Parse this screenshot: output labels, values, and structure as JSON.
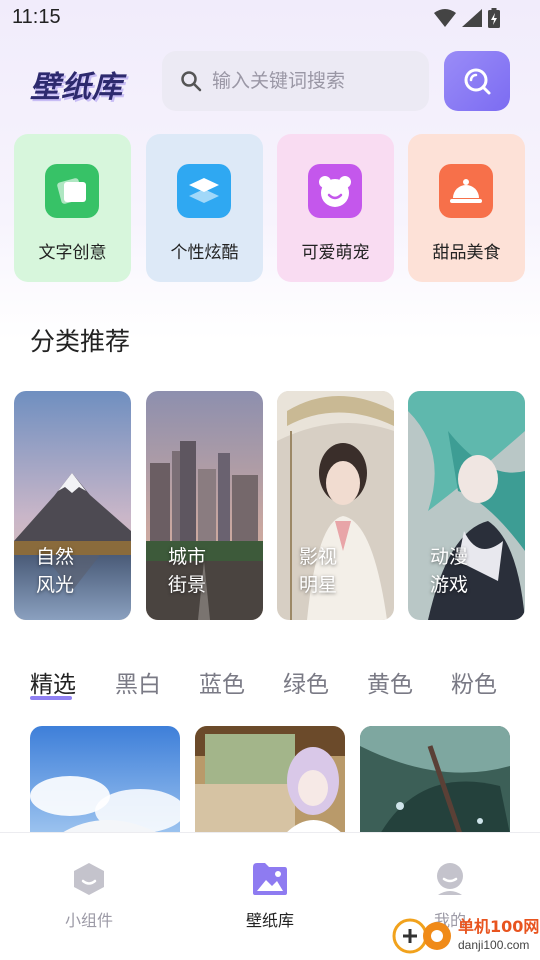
{
  "status_bar": {
    "time": "11:15"
  },
  "header": {
    "logo": "壁纸库",
    "search": {
      "placeholder": "输入关键词搜索",
      "value": ""
    }
  },
  "quick_categories": [
    {
      "label": "文字创意",
      "bg": "#d7f6dc",
      "icon_bg": "#37c267",
      "icon": "cards-icon"
    },
    {
      "label": "个性炫酷",
      "bg": "#dde9f7",
      "icon_bg": "#2fa8f2",
      "icon": "layers-icon"
    },
    {
      "label": "可爱萌宠",
      "bg": "#f9dcf2",
      "icon_bg": "#c457ec",
      "icon": "bear-icon"
    },
    {
      "label": "甜品美食",
      "bg": "#fde1d7",
      "icon_bg": "#f7704a",
      "icon": "cloche-icon"
    }
  ],
  "section": {
    "title": "分类推荐"
  },
  "recommended": [
    {
      "line1": "自然",
      "line2": "风光"
    },
    {
      "line1": "城市",
      "line2": "街景"
    },
    {
      "line1": "影视",
      "line2": "明星"
    },
    {
      "line1": "动漫",
      "line2": "游戏"
    }
  ],
  "tabs": [
    "精选",
    "黑白",
    "蓝色",
    "绿色",
    "黄色",
    "粉色"
  ],
  "active_tab": "精选",
  "bottom_nav": [
    {
      "label": "小组件",
      "active": false
    },
    {
      "label": "壁纸库",
      "active": true
    },
    {
      "label": "我的",
      "active": false
    }
  ],
  "watermark": {
    "name": "单机100网",
    "domain": "danji100.com"
  },
  "colors": {
    "accent": "#8f80f2",
    "logo": "#2d2a6e"
  }
}
